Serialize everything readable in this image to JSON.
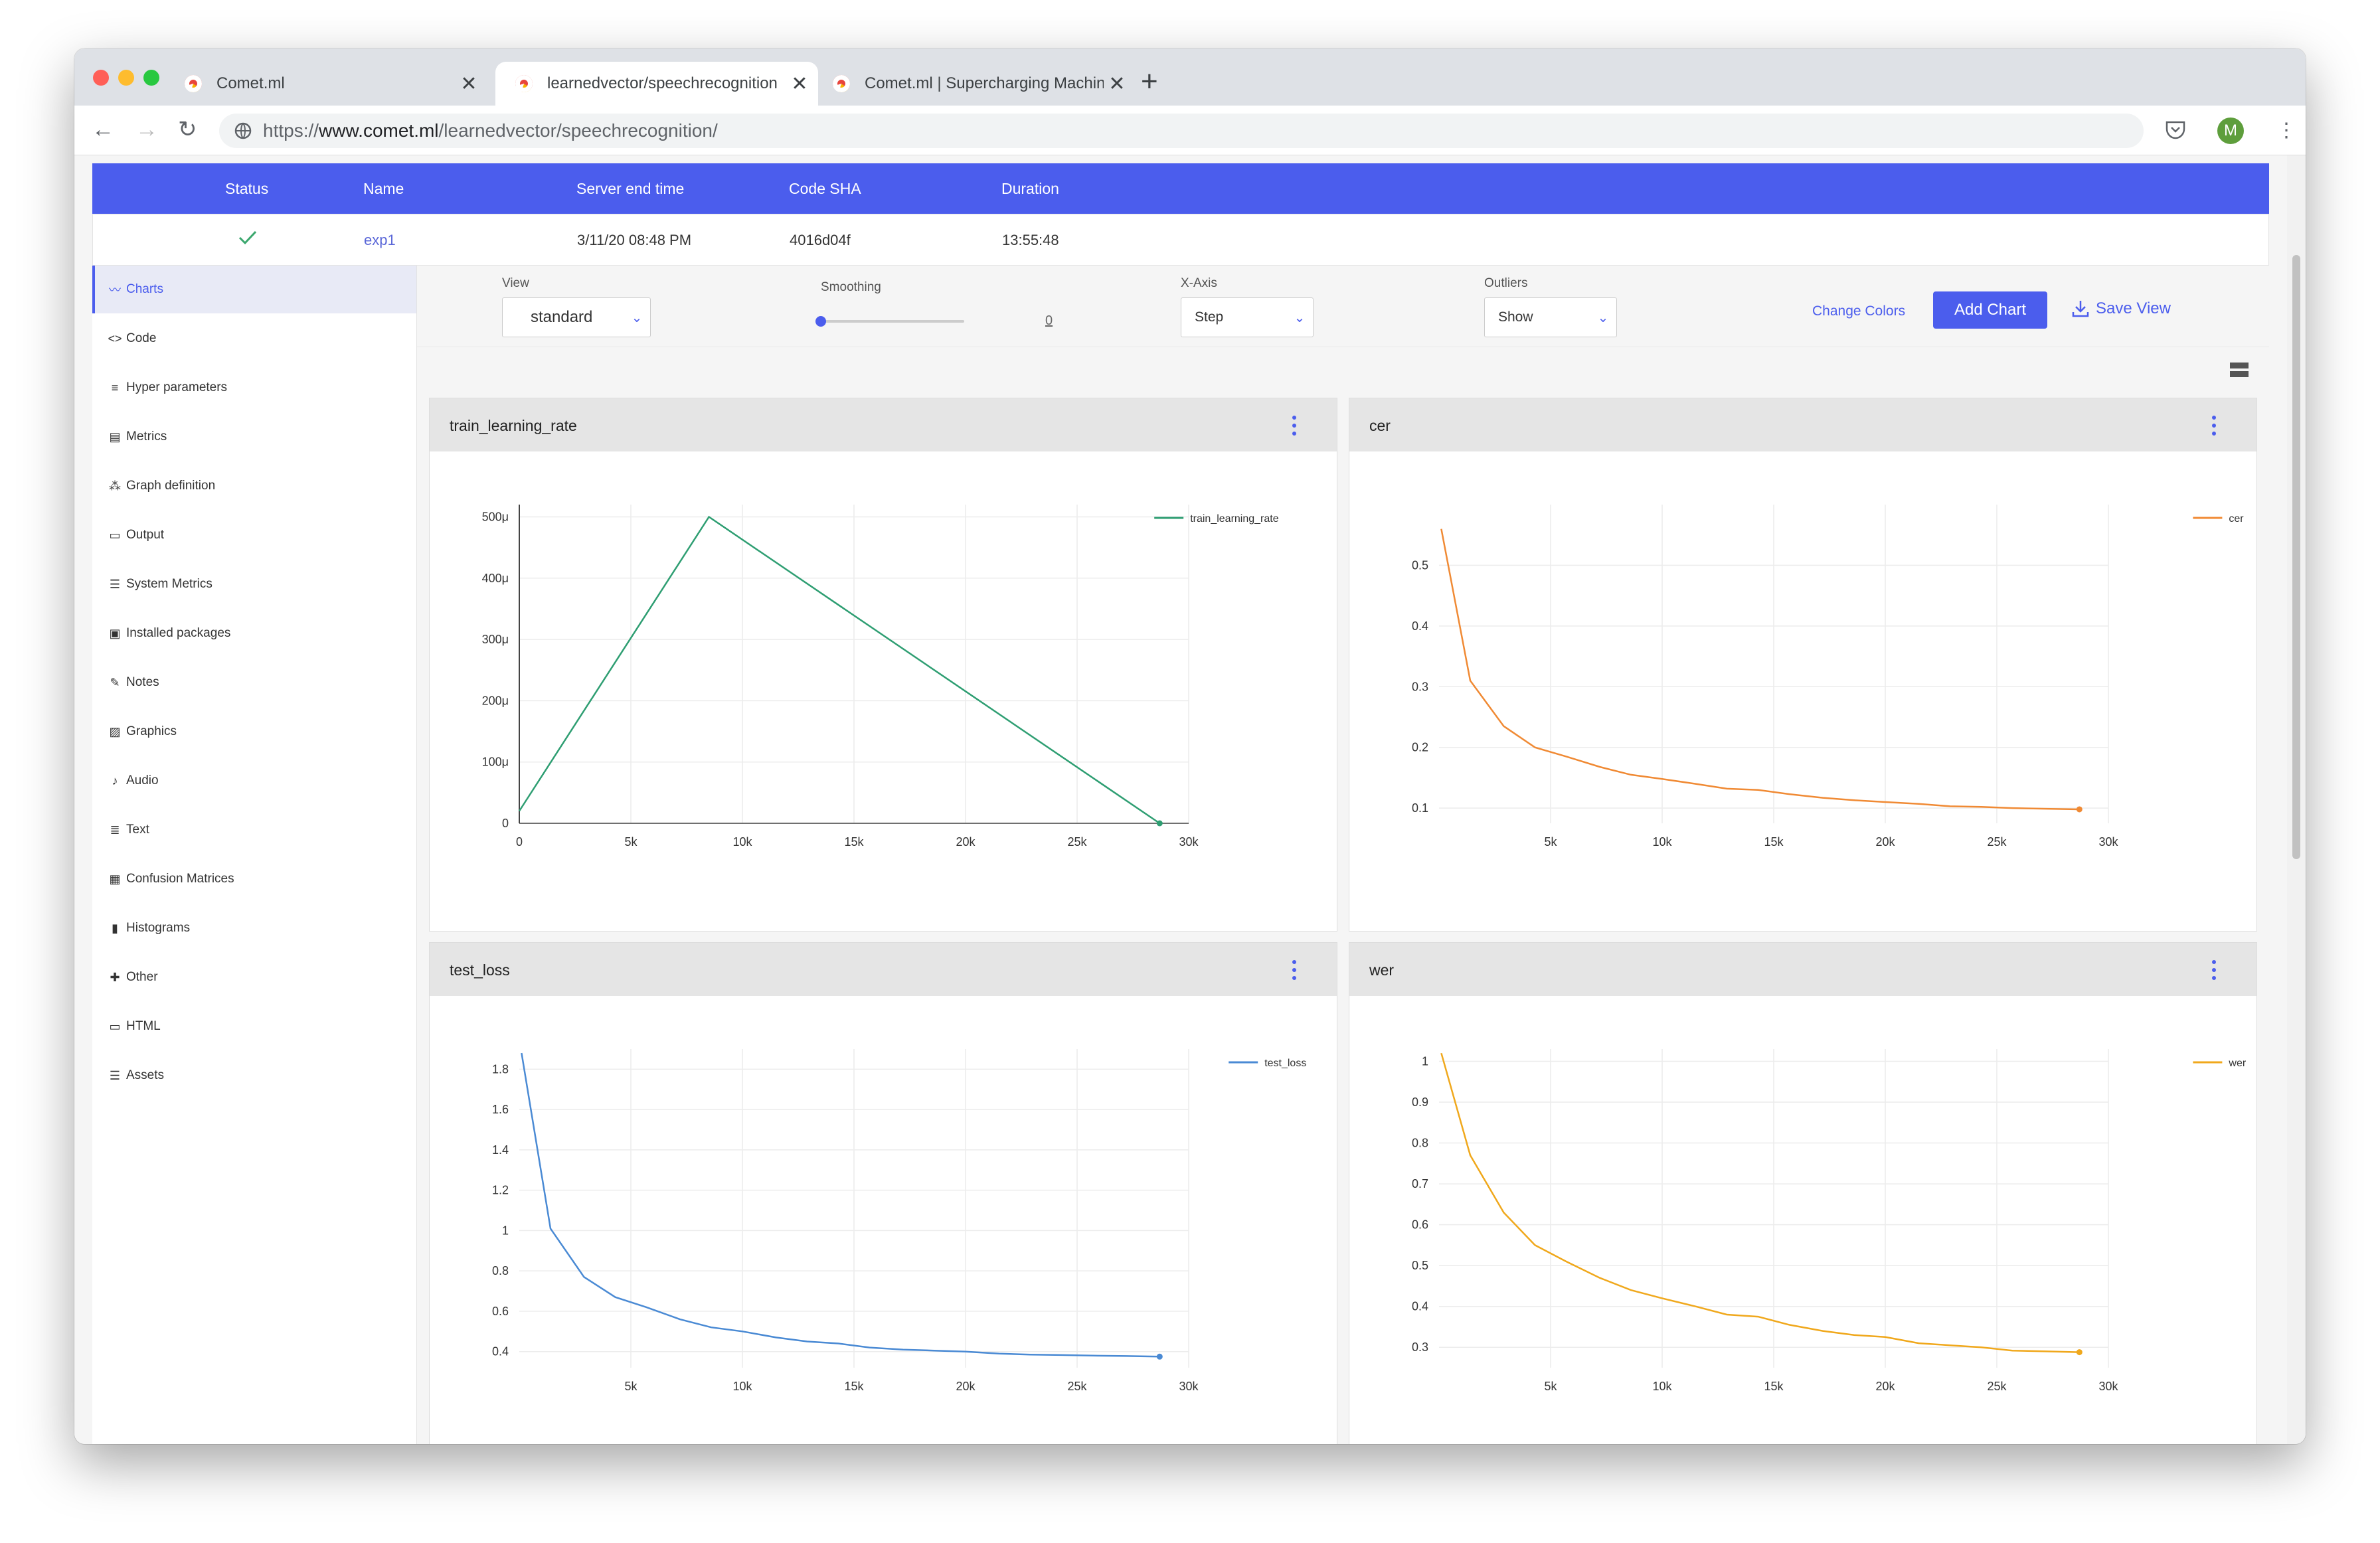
{
  "browser": {
    "tabs": [
      {
        "label": "Comet.ml"
      },
      {
        "label": "learnedvector/speechrecognition"
      },
      {
        "label": "Comet.ml | Supercharging Machine Learning"
      }
    ],
    "url_prefix": "https://",
    "url_host": "www.comet.ml",
    "url_path": "/learnedvector/speechrecognition/",
    "avatar_letter": "M"
  },
  "experiment": {
    "headers": {
      "status": "Status",
      "name": "Name",
      "server_end_time": "Server end time",
      "code_sha": "Code SHA",
      "duration": "Duration"
    },
    "row": {
      "status_icon": "check-icon",
      "name": "exp1",
      "server_end_time": "3/11/20 08:48 PM",
      "code_sha": "4016d04f",
      "duration": "13:55:48"
    }
  },
  "sidebar": {
    "items": [
      {
        "label": "Charts",
        "icon": "chart-line-icon",
        "active": true
      },
      {
        "label": "Code",
        "icon": "code-icon"
      },
      {
        "label": "Hyper parameters",
        "icon": "list-icon"
      },
      {
        "label": "Metrics",
        "icon": "table-icon"
      },
      {
        "label": "Graph definition",
        "icon": "graph-icon"
      },
      {
        "label": "Output",
        "icon": "laptop-icon"
      },
      {
        "label": "System Metrics",
        "icon": "server-icon"
      },
      {
        "label": "Installed packages",
        "icon": "briefcase-icon"
      },
      {
        "label": "Notes",
        "icon": "pencil-icon"
      },
      {
        "label": "Graphics",
        "icon": "image-icon"
      },
      {
        "label": "Audio",
        "icon": "music-icon"
      },
      {
        "label": "Text",
        "icon": "text-icon"
      },
      {
        "label": "Confusion Matrices",
        "icon": "grid-icon"
      },
      {
        "label": "Histograms",
        "icon": "bar-chart-icon"
      },
      {
        "label": "Other",
        "icon": "puzzle-icon"
      },
      {
        "label": "HTML",
        "icon": "window-icon"
      },
      {
        "label": "Assets",
        "icon": "list-icon"
      }
    ]
  },
  "controls": {
    "view_label": "View",
    "view_value": "standard",
    "smoothing_label": "Smoothing",
    "smoothing_value": "0",
    "xaxis_label": "X-Axis",
    "xaxis_value": "Step",
    "outliers_label": "Outliers",
    "outliers_value": "Show",
    "change_colors": "Change Colors",
    "add_chart": "Add Chart",
    "save_view": "Save View"
  },
  "colors": {
    "accent": "#4b5ded",
    "green": "#2e9e72",
    "orange": "#f08a34",
    "blue": "#4a8ad4",
    "yellow": "#f0a81c"
  },
  "chart_data": [
    {
      "type": "line",
      "title": "train_learning_rate",
      "xlim": [
        0,
        30000
      ],
      "ylim": [
        0,
        0.00052
      ],
      "xticks": [
        0,
        5000,
        10000,
        15000,
        20000,
        25000,
        30000
      ],
      "xtick_labels": [
        "0",
        "5k",
        "10k",
        "15k",
        "20k",
        "25k",
        "30k"
      ],
      "yticks": [
        0,
        0.0001,
        0.0002,
        0.0003,
        0.0004,
        0.0005
      ],
      "ytick_labels": [
        "0",
        "100μ",
        "200μ",
        "300μ",
        "400μ",
        "500μ"
      ],
      "legend": "top-right",
      "series": [
        {
          "name": "train_learning_rate",
          "color": "#2e9e72",
          "x": [
            0,
            8500,
            28700
          ],
          "y": [
            2e-05,
            0.0005,
            0.0
          ]
        }
      ]
    },
    {
      "type": "line",
      "title": "cer",
      "xlim": [
        0,
        30000
      ],
      "ylim": [
        0.075,
        0.6
      ],
      "xticks": [
        5000,
        10000,
        15000,
        20000,
        25000,
        30000
      ],
      "xtick_labels": [
        "5k",
        "10k",
        "15k",
        "20k",
        "25k",
        "30k"
      ],
      "yticks": [
        0.1,
        0.2,
        0.3,
        0.4,
        0.5
      ],
      "ytick_labels": [
        "0.1",
        "0.2",
        "0.3",
        "0.4",
        "0.5"
      ],
      "legend": "top-right",
      "series": [
        {
          "name": "cer",
          "color": "#f08a34",
          "x": [
            100,
            1400,
            2900,
            4300,
            5700,
            7200,
            8600,
            10000,
            11500,
            12900,
            14300,
            15700,
            17200,
            18600,
            20000,
            21500,
            22900,
            24300,
            25700,
            27200,
            28700
          ],
          "y": [
            0.56,
            0.31,
            0.235,
            0.2,
            0.185,
            0.168,
            0.155,
            0.148,
            0.14,
            0.132,
            0.13,
            0.123,
            0.117,
            0.113,
            0.11,
            0.107,
            0.103,
            0.102,
            0.1,
            0.099,
            0.098
          ]
        }
      ]
    },
    {
      "type": "line",
      "title": "test_loss",
      "xlim": [
        0,
        30000
      ],
      "ylim": [
        0.32,
        1.9
      ],
      "xticks": [
        5000,
        10000,
        15000,
        20000,
        25000,
        30000
      ],
      "xtick_labels": [
        "5k",
        "10k",
        "15k",
        "20k",
        "25k",
        "30k"
      ],
      "yticks": [
        0.4,
        0.6,
        0.8,
        1.0,
        1.2,
        1.4,
        1.6,
        1.8
      ],
      "ytick_labels": [
        "0.4",
        "0.6",
        "0.8",
        "1",
        "1.2",
        "1.4",
        "1.6",
        "1.8"
      ],
      "legend": "top-right",
      "series": [
        {
          "name": "test_loss",
          "color": "#4a8ad4",
          "x": [
            100,
            1400,
            2900,
            4300,
            5700,
            7200,
            8600,
            10000,
            11500,
            12900,
            14300,
            15700,
            17200,
            18600,
            20000,
            21500,
            22900,
            24300,
            25700,
            27200,
            28700
          ],
          "y": [
            1.88,
            1.01,
            0.77,
            0.67,
            0.62,
            0.56,
            0.52,
            0.5,
            0.47,
            0.45,
            0.44,
            0.42,
            0.41,
            0.405,
            0.4,
            0.39,
            0.385,
            0.383,
            0.38,
            0.378,
            0.375
          ]
        }
      ]
    },
    {
      "type": "line",
      "title": "wer",
      "xlim": [
        0,
        30000
      ],
      "ylim": [
        0.25,
        1.03
      ],
      "xticks": [
        5000,
        10000,
        15000,
        20000,
        25000,
        30000
      ],
      "xtick_labels": [
        "5k",
        "10k",
        "15k",
        "20k",
        "25k",
        "30k"
      ],
      "yticks": [
        0.3,
        0.4,
        0.5,
        0.6,
        0.7,
        0.8,
        0.9,
        1.0
      ],
      "ytick_labels": [
        "0.3",
        "0.4",
        "0.5",
        "0.6",
        "0.7",
        "0.8",
        "0.9",
        "1"
      ],
      "legend": "top-right",
      "series": [
        {
          "name": "wer",
          "color": "#f0a81c",
          "x": [
            100,
            1400,
            2900,
            4300,
            5700,
            7200,
            8600,
            10000,
            11500,
            12900,
            14300,
            15700,
            17200,
            18600,
            20000,
            21500,
            22900,
            24300,
            25700,
            27200,
            28700
          ],
          "y": [
            1.02,
            0.77,
            0.63,
            0.55,
            0.51,
            0.47,
            0.44,
            0.42,
            0.4,
            0.38,
            0.375,
            0.355,
            0.34,
            0.33,
            0.325,
            0.31,
            0.305,
            0.3,
            0.292,
            0.29,
            0.288
          ]
        }
      ]
    }
  ]
}
